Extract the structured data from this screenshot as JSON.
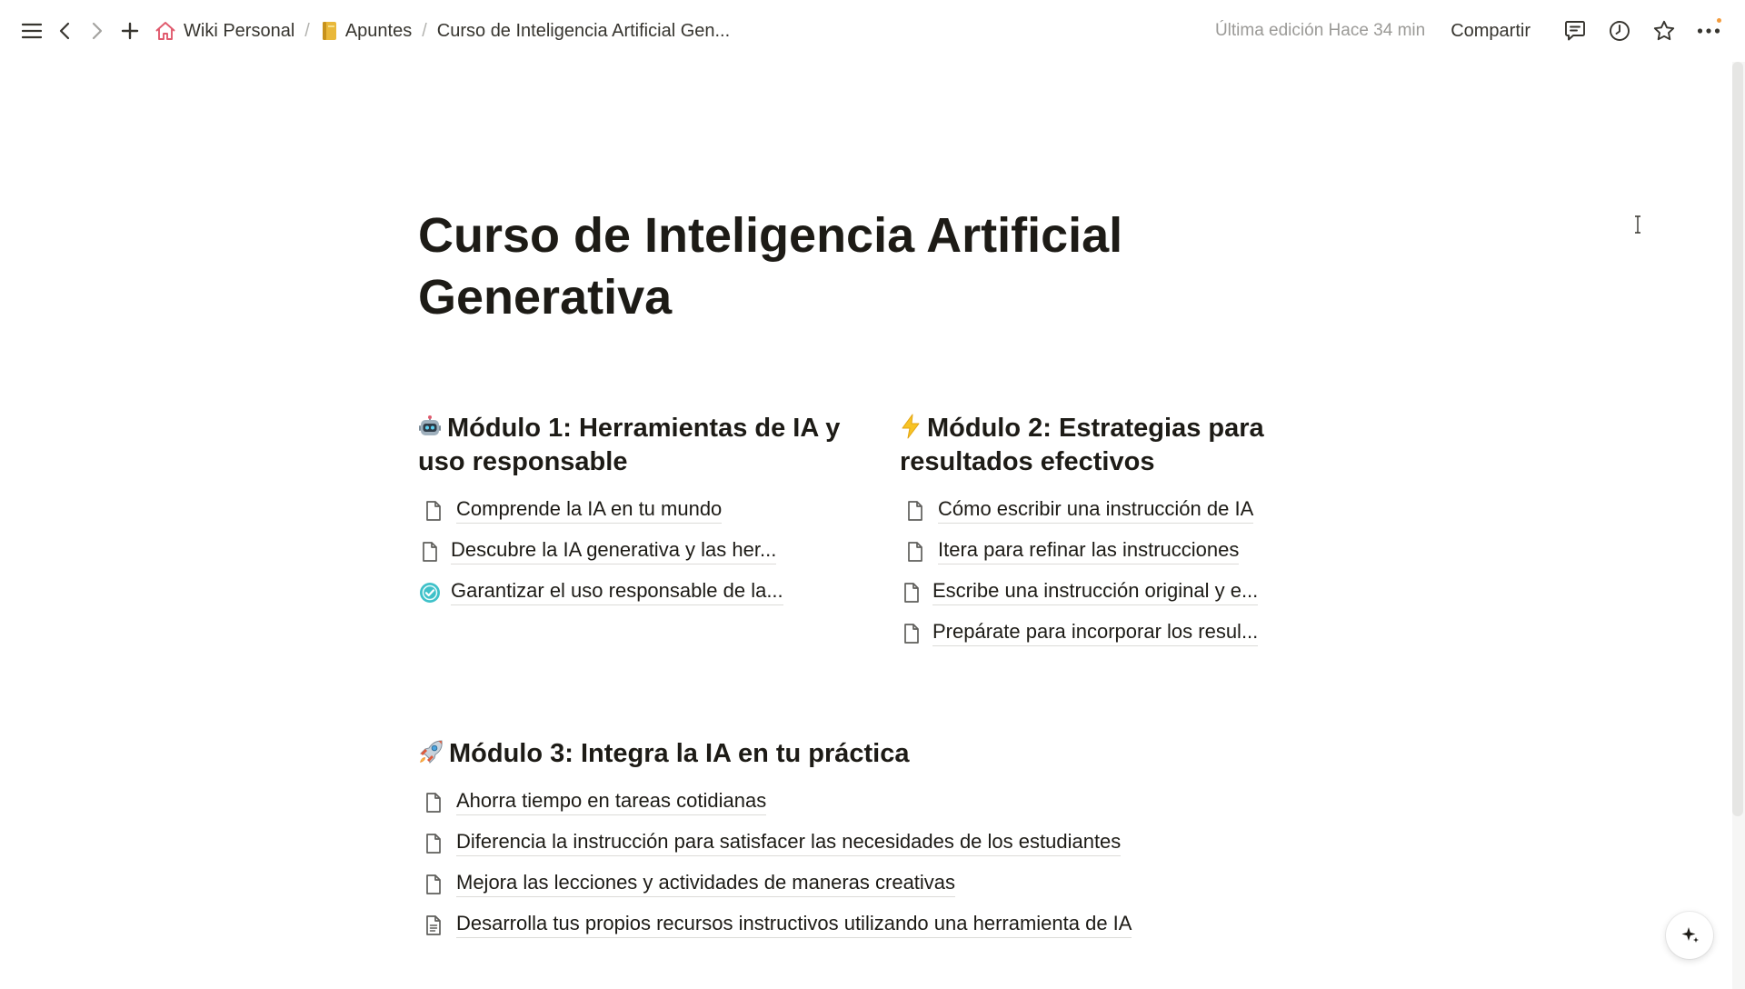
{
  "breadcrumb": {
    "items": [
      {
        "label": "Wiki Personal",
        "icon": "home-icon"
      },
      {
        "label": "Apuntes",
        "icon": "notebook-icon"
      },
      {
        "label": "Curso de Inteligencia Artificial Gen..."
      }
    ],
    "separator": "/"
  },
  "topbar": {
    "edited": "Última edición Hace 34 min",
    "share_label": "Compartir",
    "accent_dot_color": "#f39c3d"
  },
  "page": {
    "title": "Curso de Inteligencia Artificial Generativa",
    "modules": [
      {
        "emoji_icon": "robot-icon",
        "title": "Módulo 1: Herramientas de IA y uso responsable",
        "items": [
          {
            "label": "Comprende la IA en tu mundo",
            "icon": "page-icon"
          },
          {
            "label": "Descubre la IA generativa y las her...",
            "icon": "page-icon"
          },
          {
            "label": "Garantizar el uso responsable de la...",
            "icon": "check-circle-icon"
          }
        ]
      },
      {
        "emoji_icon": "lightning-icon",
        "title": "Módulo 2: Estrategias para resultados efectivos",
        "items": [
          {
            "label": "Cómo escribir una instrucción de IA",
            "icon": "page-icon"
          },
          {
            "label": "Itera para refinar las instrucciones",
            "icon": "page-icon"
          },
          {
            "label": "Escribe una instrucción original y e...",
            "icon": "page-icon"
          },
          {
            "label": "Prepárate para incorporar los resul...",
            "icon": "page-icon"
          }
        ]
      },
      {
        "emoji_icon": "rocket-icon",
        "title": "Módulo 3: Integra la IA en tu práctica",
        "items": [
          {
            "label": "Ahorra tiempo en tareas cotidianas",
            "icon": "page-icon"
          },
          {
            "label": "Diferencia la instrucción para satisfacer las necesidades de los estudiantes",
            "icon": "page-icon"
          },
          {
            "label": "Mejora las lecciones y actividades de maneras creativas",
            "icon": "page-icon"
          },
          {
            "label": "Desarrolla tus propios recursos instructivos utilizando una herramienta de IA",
            "icon": "page-text-icon"
          }
        ]
      }
    ]
  }
}
